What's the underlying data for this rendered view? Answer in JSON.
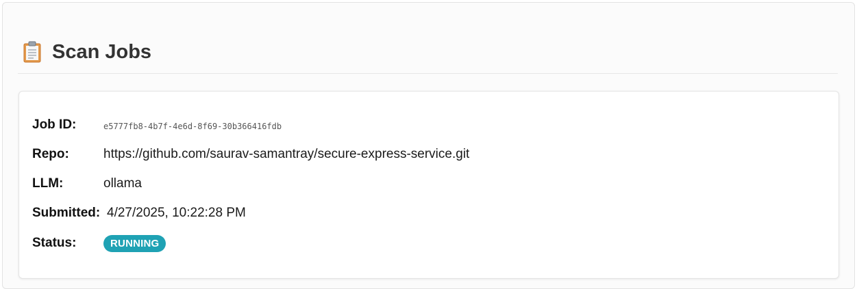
{
  "header": {
    "icon": "clipboard-icon",
    "title": "Scan Jobs"
  },
  "job": {
    "job_id_label": "Job ID:",
    "job_id": "e5777fb8-4b7f-4e6d-8f69-30b366416fdb",
    "repo_label": "Repo:",
    "repo": "https://github.com/saurav-samantray/secure-express-service.git",
    "llm_label": "LLM:",
    "llm": "ollama",
    "submitted_label": "Submitted:",
    "submitted": "4/27/2025, 10:22:28 PM",
    "status_label": "Status:",
    "status": "RUNNING",
    "status_color": "#1fa2b4"
  }
}
